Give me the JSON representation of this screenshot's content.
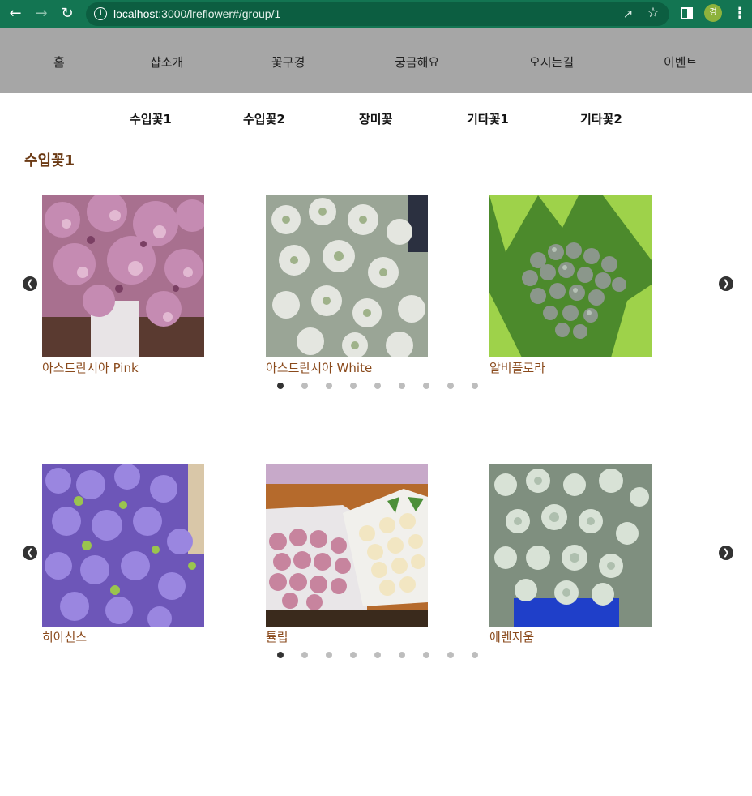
{
  "browser": {
    "url_host": "localhost",
    "url_rest": ":3000/lreflower#/group/1",
    "profile_initial": "경"
  },
  "top_nav": [
    "홈",
    "샵소개",
    "꽃구경",
    "궁금해요",
    "오시는길",
    "이벤트"
  ],
  "sub_nav": [
    "수입꽃1",
    "수입꽃2",
    "장미꽃",
    "기타꽃1",
    "기타꽃2"
  ],
  "section_title": "수입꽃1",
  "carousels": [
    {
      "items": [
        {
          "caption": "아스트란시아 Pink"
        },
        {
          "caption": "아스트란시아 White"
        },
        {
          "caption": "알비플로라"
        }
      ],
      "dot_count": 9,
      "active_dot": 0
    },
    {
      "items": [
        {
          "caption": "히아신스"
        },
        {
          "caption": "튤립"
        },
        {
          "caption": "에렌지움"
        }
      ],
      "dot_count": 9,
      "active_dot": 0
    }
  ],
  "colors": {
    "chrome_bg": "#137552",
    "top_nav_bg": "#a6a6a6",
    "title": "#6b3a14",
    "caption": "#8a4a1c"
  }
}
